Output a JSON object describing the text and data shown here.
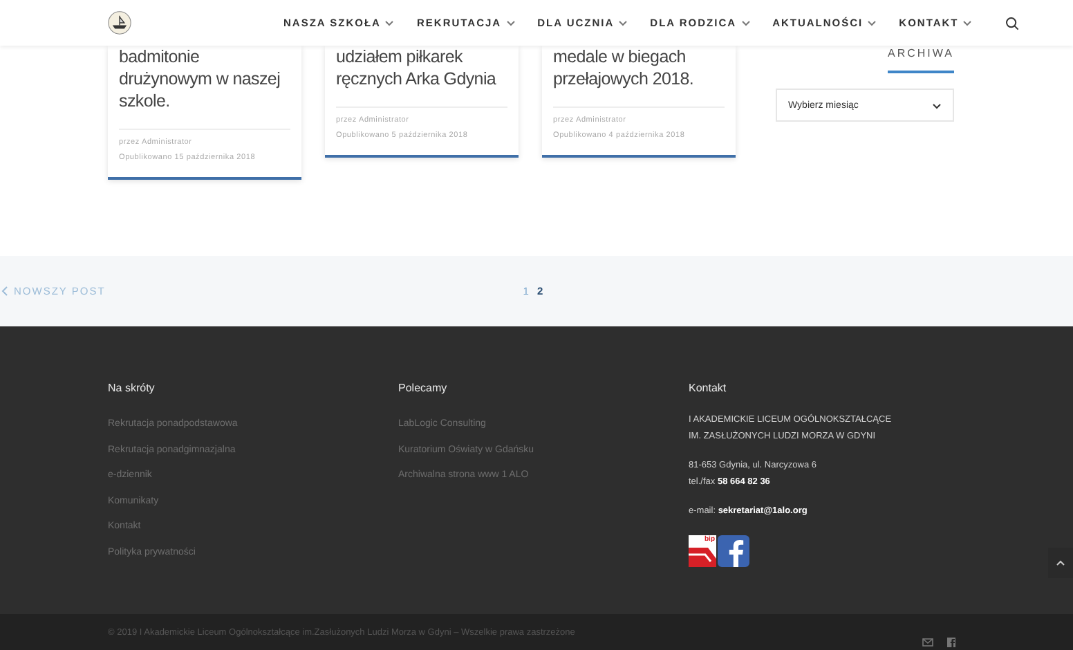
{
  "header": {
    "nav": [
      {
        "label": "NASZA SZKOŁA"
      },
      {
        "label": "REKRUTACJA"
      },
      {
        "label": "DLA UCZNIA"
      },
      {
        "label": "DLA RODZICA"
      },
      {
        "label": "AKTUALNOŚCI"
      },
      {
        "label": "KONTAKT"
      }
    ]
  },
  "posts": [
    {
      "title": "badmitonie drużynowym w naszej szkole.",
      "author": "przez Administrator",
      "date": "Opublikowano 15 października 2018"
    },
    {
      "title": "udziałem piłkarek ręcznych Arka Gdynia",
      "author": "przez Administrator",
      "date": "Opublikowano 5 października 2018"
    },
    {
      "title": "medale w biegach przełajowych 2018.",
      "author": "przez Administrator",
      "date": "Opublikowano 4 października 2018"
    }
  ],
  "sidebar": {
    "heading": "ARCHIWA",
    "select": {
      "value": "Wybierz miesiąc"
    }
  },
  "pagination": {
    "newer": "NOWSZY POST",
    "pages": [
      {
        "label": "1",
        "selected": false
      },
      {
        "label": "2",
        "selected": true
      }
    ]
  },
  "footer": {
    "columns": [
      {
        "heading": "Na skróty",
        "links": [
          "Rekrutacja ponadpodstawowa",
          "Rekrutacja ponadgimnazjalna",
          "e-dziennik",
          "Komunikaty",
          "Kontakt",
          "Polityka prywatności"
        ]
      },
      {
        "heading": "Polecamy",
        "links": [
          "LabLogic Consulting",
          "Kuratorium Oświaty w Gdańsku",
          "Archiwalna strona www 1 ALO"
        ]
      }
    ],
    "contact": {
      "heading": "Kontakt",
      "name": [
        "I AKADEMICKIE LICEUM OGÓLNOKSZTAŁCĄCE",
        "IM. ZASŁUŻONYCH LUDZI MORZA W GDYNI"
      ],
      "address": [
        "81-653 Gdynia, ul. Narcyzowa 6",
        "tel./fax **58 664 82 36**"
      ],
      "email": "e-mail: **sekretariat@1alo.org**",
      "badge": "bip"
    }
  },
  "copyright": "© 2019 I Akademickie Liceum Ogólnokształcące im.Zasłużonych Ludzi Morza w Gdyni – Wszelkie prawa zastrzeżone"
}
